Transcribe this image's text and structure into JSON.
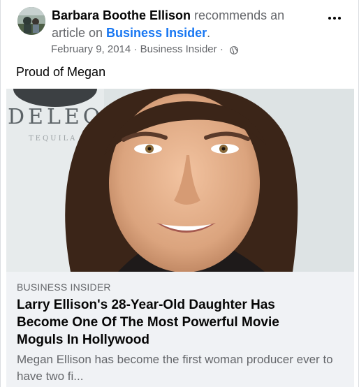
{
  "post": {
    "author": "Barbara Boothe Ellison",
    "action_text": " recommends an article on ",
    "page_name": "Business Insider",
    "trailing_punct": ".",
    "date": "February 9, 2014",
    "sep1": " · ",
    "source_name": "Business Insider",
    "sep2": " · ",
    "privacy_icon": "globe-icon",
    "more_icon": "more-options-icon",
    "caption": "Proud of Megan"
  },
  "link_preview": {
    "photo_sign_text": "DELEO",
    "photo_sign_subtext": "TEQUILA",
    "source": "BUSINESS INSIDER",
    "headline": "Larry Ellison's 28-Year-Old Daughter Has Become One Of The Most Powerful Movie Moguls In Hollywood",
    "description": "Megan Ellison has become the first woman producer ever to have two fi..."
  },
  "colors": {
    "link_blue": "#1877f2",
    "secondary_text": "#65676b",
    "preview_bg": "#f0f2f5"
  }
}
